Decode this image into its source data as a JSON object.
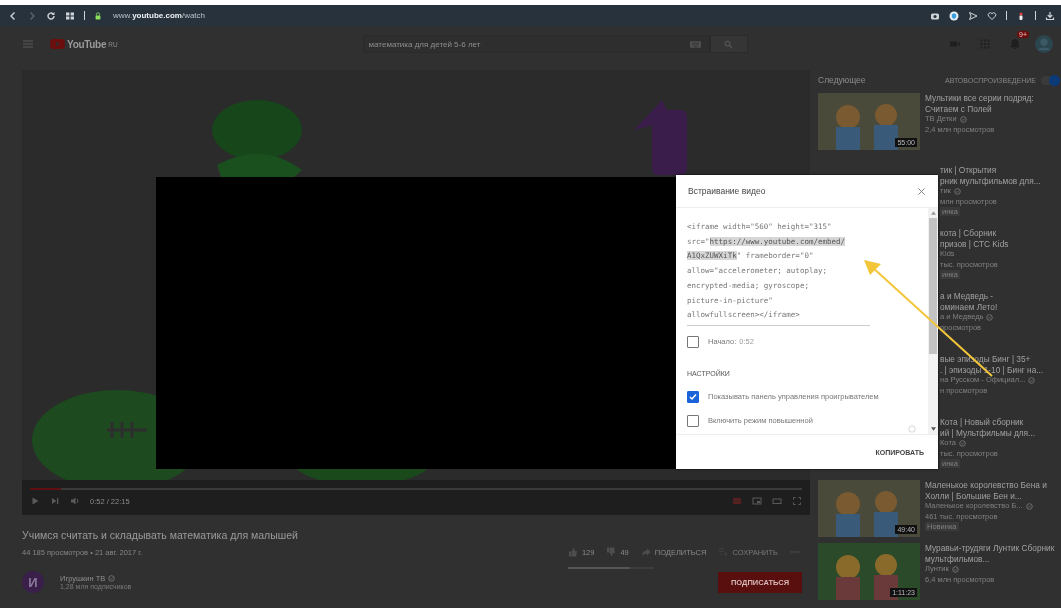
{
  "browser": {
    "url": "www.**youtube.com**/watch"
  },
  "header": {
    "logo": "YouTube",
    "region": "RU",
    "search": {
      "value": "математика для детей 5-6 лет"
    },
    "notifications_badge": "9+"
  },
  "player": {
    "time": "0:52 / 22:15",
    "level": 0.04
  },
  "video": {
    "title": "Учимся считать и складывать математика для малышей",
    "stats": "44 185 просмотров • 21 авг. 2017 г.",
    "actions": [
      {
        "kind": "like",
        "label": "129"
      },
      {
        "kind": "dislike",
        "label": "49"
      },
      {
        "kind": "share",
        "label": "ПОДЕЛИТЬСЯ"
      },
      {
        "kind": "save",
        "label": "СОХРАНИТЬ"
      },
      {
        "kind": "more"
      }
    ],
    "sentiment": {
      "level": 0.72
    }
  },
  "channel": {
    "initial": "И",
    "name": "Игрушкин ТВ",
    "subscribers": "1,28 млн подписчиков",
    "subscribe": "ПОДПИСАТЬСЯ"
  },
  "sidebar": {
    "heading": "Следующее",
    "autoplay": {
      "label": "АВТОВОСПРОИЗВЕДЕНИЕ",
      "on": true
    },
    "items": [
      {
        "kind": "full",
        "title": "Мультики все серии подряд: Считаем с Полей",
        "channel": "ТВ Детки",
        "verified": true,
        "views": "2,4 млн просмотров",
        "duration": "55:00"
      },
      {
        "kind": "partial",
        "title": "тик | Открытия",
        "title_2": "рник мультфильмов для...",
        "channel": "тик",
        "verified": true,
        "views": "млн просмотров",
        "badge": "инка"
      },
      {
        "kind": "partial",
        "title": "кота | Сборник",
        "title_2": "призов | СТС Kids",
        "channel": "Kids",
        "verified": false,
        "views": "тыс. просмотров",
        "badge": "инка"
      },
      {
        "kind": "partial",
        "title": "а и Медведь -",
        "title_2": "оминаем Лето!",
        "channel": "а и Медведь",
        "verified": true,
        "views": "просмотров"
      },
      {
        "kind": "partial",
        "title": "вые эпизоды Бинг | 35+",
        "title_2": ". | эпизоды 1-10 | Бинг на...",
        "channel": "на Русском - Официал...",
        "verified": true,
        "views": "н просмотров"
      },
      {
        "kind": "partial",
        "title": "Кота | Новый сборник",
        "title_2": "ий | Мультфильмы для...",
        "channel": "Кота",
        "verified": true,
        "views": "тыс. просмотров",
        "badge": "инка"
      },
      {
        "kind": "full",
        "title": "Маленькое королевство Бена и Холли | Большие Бен и...",
        "channel": "Маленькое королевство Б...",
        "verified": true,
        "views": "461 тыс. просмотров",
        "badge": "Новинка",
        "duration": "49:40"
      },
      {
        "kind": "full",
        "title": "Муравьи-трудяги Лунтик Сборник мультфильмов...",
        "channel": "Лунтик",
        "verified": true,
        "views": "6,4 млн просмотров",
        "duration": "1:11:23"
      }
    ]
  },
  "dialog": {
    "title": "Встраивание видео",
    "code": [
      {
        "text": "<iframe width=\"560\" height=\"315\"\nsrc=\"",
        "selected": false
      },
      {
        "text": "https://www.youtube.com/embed/\nA1QxZUWXiTk",
        "selected": true
      },
      {
        "text": "\" frameborder=\"0\"\nallow=\"accelerometer; autoplay;\nencrypted-media; gyroscope;\npicture-in-picture\"\nallowfullscreen></iframe>",
        "selected": false
      }
    ],
    "start": {
      "label": "Начало:",
      "time": "0:52",
      "checked": false
    },
    "settings_heading": "НАСТРОЙКИ",
    "options": [
      {
        "label": "Показывать панель управления проигрывателем",
        "checked": true
      },
      {
        "label": "Включить режим повышенной",
        "checked": false
      }
    ],
    "copy": "КОПИРОВАТЬ"
  }
}
